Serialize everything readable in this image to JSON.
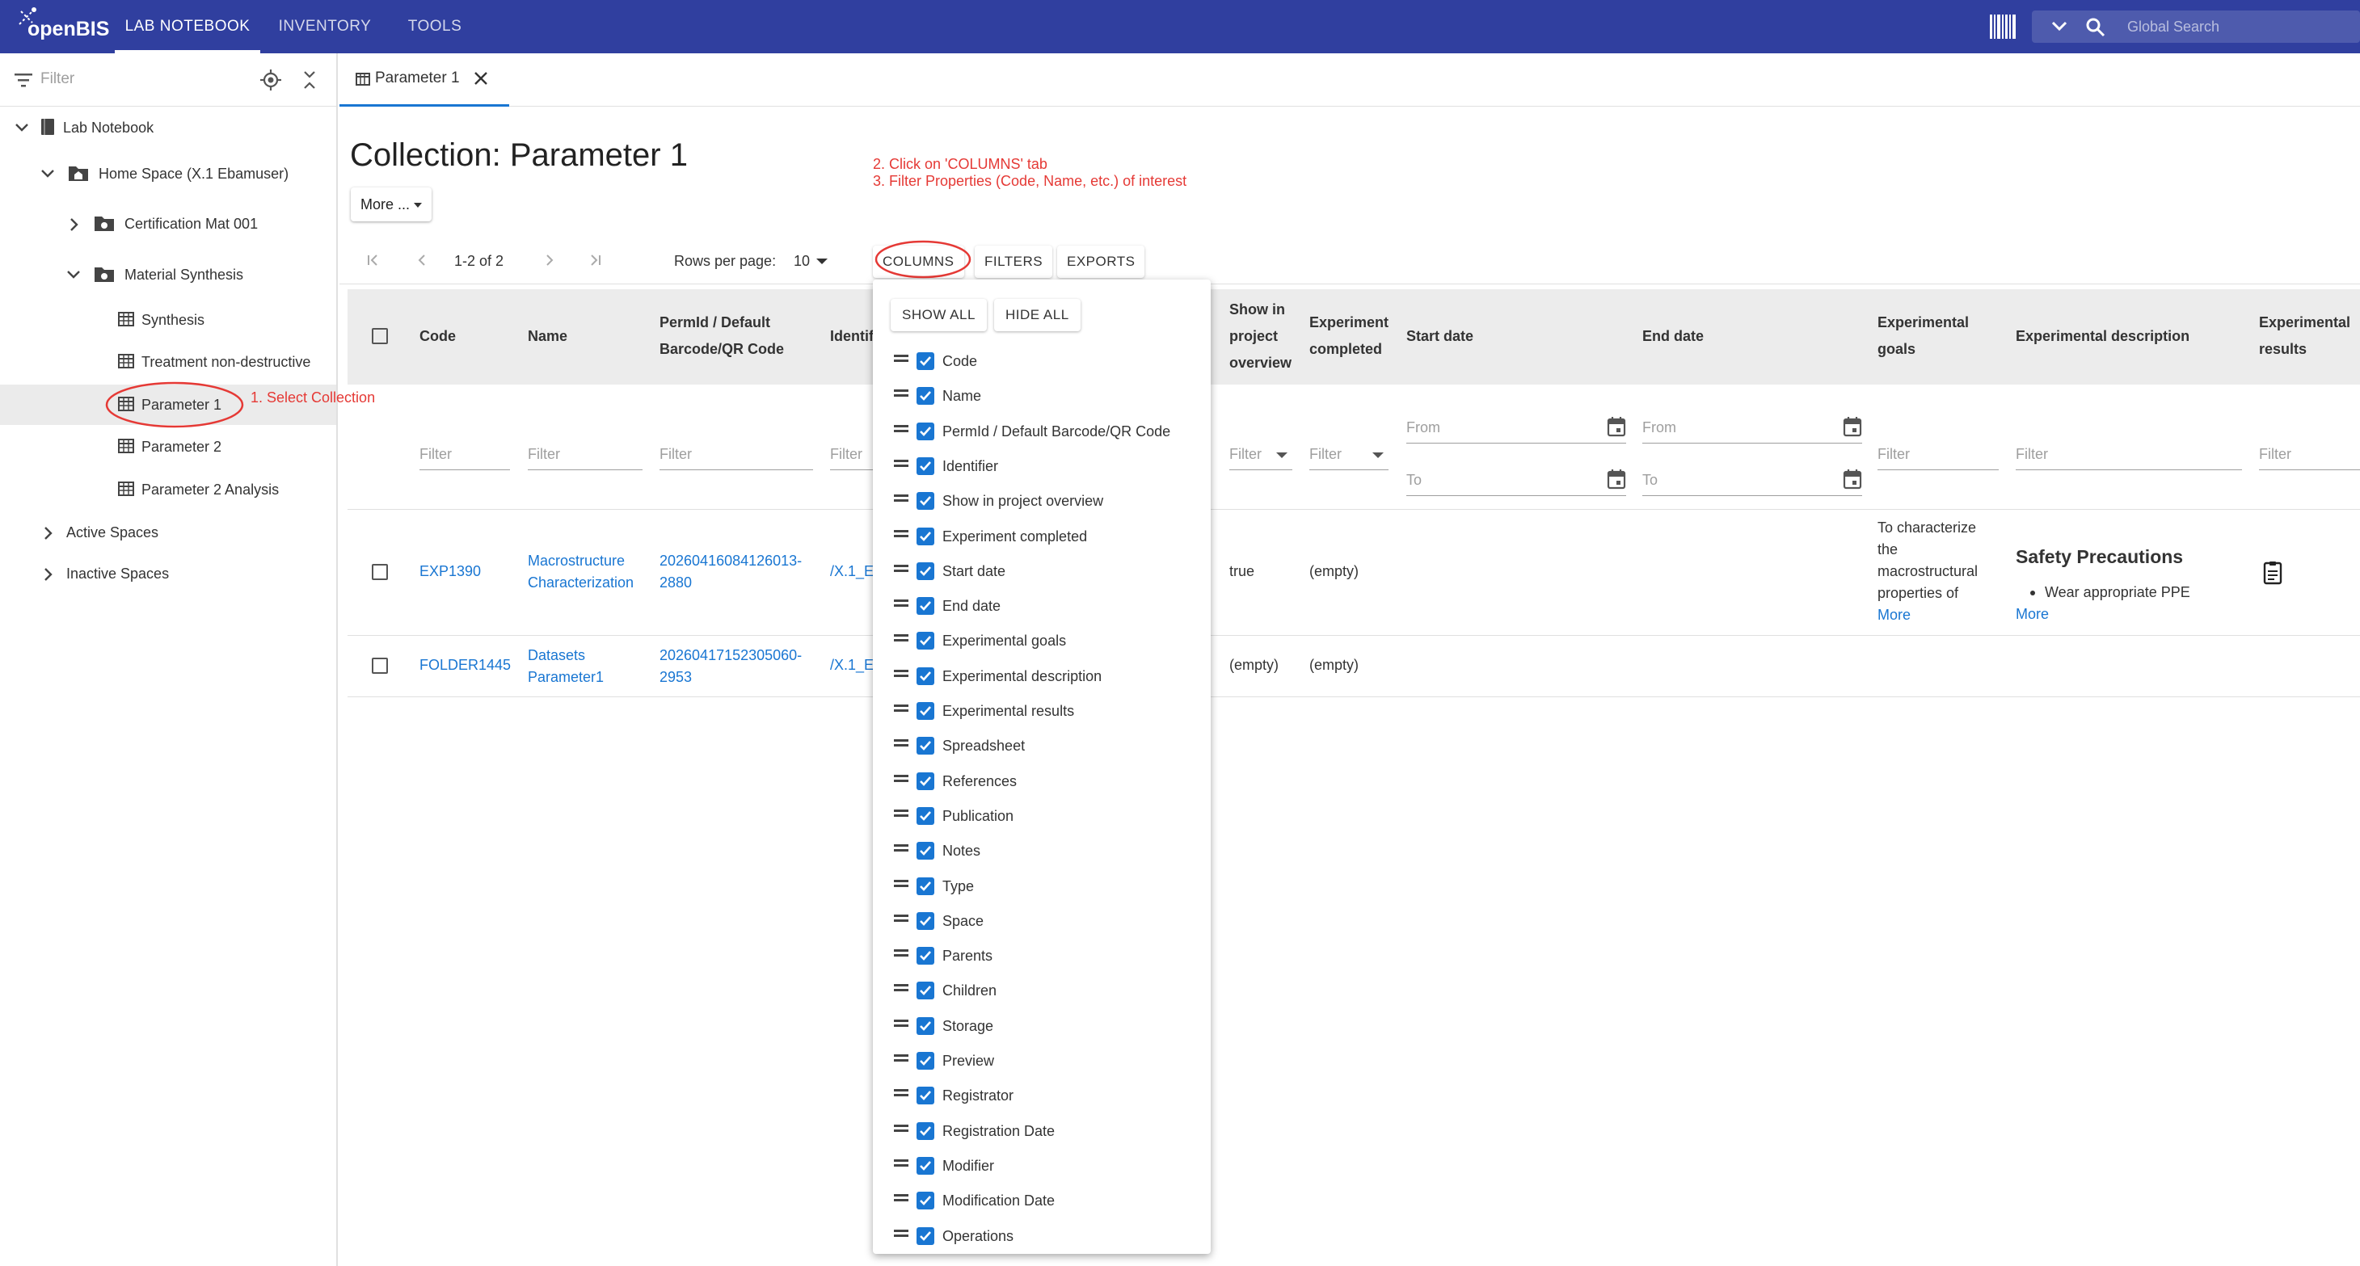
{
  "app": {
    "logo_text": "openBIS"
  },
  "nav": {
    "tabs": [
      {
        "label": "LAB NOTEBOOK"
      },
      {
        "label": "INVENTORY"
      },
      {
        "label": "TOOLS"
      }
    ]
  },
  "global_search": {
    "placeholder": "Global Search"
  },
  "sidebar": {
    "filter_placeholder": "Filter",
    "tree": [
      {
        "label": "Lab Notebook"
      },
      {
        "label": "Home Space (X.1 Ebamuser)"
      },
      {
        "label": "Certification Mat 001"
      },
      {
        "label": "Material Synthesis"
      },
      {
        "label": "Synthesis"
      },
      {
        "label": "Treatment non-destructive"
      },
      {
        "label": "Parameter 1"
      },
      {
        "label": "Parameter 2"
      },
      {
        "label": "Parameter 2 Analysis"
      },
      {
        "label": "Active Spaces"
      },
      {
        "label": "Inactive Spaces"
      }
    ]
  },
  "doc_tab": {
    "label": "Parameter 1"
  },
  "page": {
    "title": "Collection: Parameter 1",
    "more_label": "More ..."
  },
  "annotations": {
    "step1": "1. Select Collection",
    "step2": "2. Click on 'COLUMNS' tab",
    "step3": "3. Filter Properties (Code, Name, etc.) of interest"
  },
  "toolbar": {
    "range": "1-2 of 2",
    "rows_per_page_label": "Rows per page:",
    "rows_per_page_value": "10",
    "columns_label": "COLUMNS",
    "filters_label": "FILTERS",
    "exports_label": "EXPORTS"
  },
  "grid": {
    "headers": {
      "code": "Code",
      "name": "Name",
      "permid_1": "PermId / Default",
      "permid_2": "Barcode/QR Code",
      "identifier": "Identifier",
      "show_1": "Show in",
      "show_2": "project",
      "show_3": "overview",
      "completed_1": "Experiment",
      "completed_2": "completed",
      "start_date": "Start date",
      "end_date": "End date",
      "goals_1": "Experimental",
      "goals_2": "goals",
      "description": "Experimental description",
      "results_1": "Experimental",
      "results_2": "results"
    },
    "filters": {
      "filter": "Filter",
      "from": "From",
      "to": "To"
    },
    "rows": [
      {
        "code": "EXP1390",
        "name_1": "Macrostructure",
        "name_2": "Characterization",
        "permid_1": "20260416084126013-",
        "permid_2": "2880",
        "identifier": "/X.1_E",
        "show": "true",
        "completed": "(empty)",
        "goals_1": "To characterize",
        "goals_2": "the",
        "goals_3": "macrostructural",
        "goals_4": "properties of",
        "goals_more": "More",
        "desc_title": "Safety Precautions",
        "desc_bullet": "Wear appropriate PPE",
        "desc_more": "More",
        "results_icon": "document-icon"
      },
      {
        "code": "FOLDER1445",
        "name_1": "Datasets",
        "name_2": "Parameter1",
        "permid_1": "20260417152305060-",
        "permid_2": "2953",
        "identifier": "/X.1_E",
        "show": "(empty)",
        "completed": "(empty)"
      }
    ]
  },
  "columns_popup": {
    "show_all": "SHOW ALL",
    "hide_all": "HIDE ALL",
    "columns": [
      {
        "label": "Code",
        "checked": true
      },
      {
        "label": "Name",
        "checked": true
      },
      {
        "label": "PermId / Default Barcode/QR Code",
        "checked": true
      },
      {
        "label": "Identifier",
        "checked": true
      },
      {
        "label": "Show in project overview",
        "checked": true
      },
      {
        "label": "Experiment completed",
        "checked": true
      },
      {
        "label": "Start date",
        "checked": true
      },
      {
        "label": "End date",
        "checked": true
      },
      {
        "label": "Experimental goals",
        "checked": true
      },
      {
        "label": "Experimental description",
        "checked": true
      },
      {
        "label": "Experimental results",
        "checked": true
      },
      {
        "label": "Spreadsheet",
        "checked": true
      },
      {
        "label": "References",
        "checked": true
      },
      {
        "label": "Publication",
        "checked": true
      },
      {
        "label": "Notes",
        "checked": true
      },
      {
        "label": "Type",
        "checked": true
      },
      {
        "label": "Space",
        "checked": true
      },
      {
        "label": "Parents",
        "checked": true
      },
      {
        "label": "Children",
        "checked": true
      },
      {
        "label": "Storage",
        "checked": true
      },
      {
        "label": "Preview",
        "checked": true
      },
      {
        "label": "Registrator",
        "checked": true
      },
      {
        "label": "Registration Date",
        "checked": true
      },
      {
        "label": "Modifier",
        "checked": true
      },
      {
        "label": "Modification Date",
        "checked": true
      },
      {
        "label": "Operations",
        "checked": true
      }
    ]
  },
  "colors": {
    "primary": "#303f9f",
    "accent": "#1976d2",
    "annotation": "#e53935"
  }
}
